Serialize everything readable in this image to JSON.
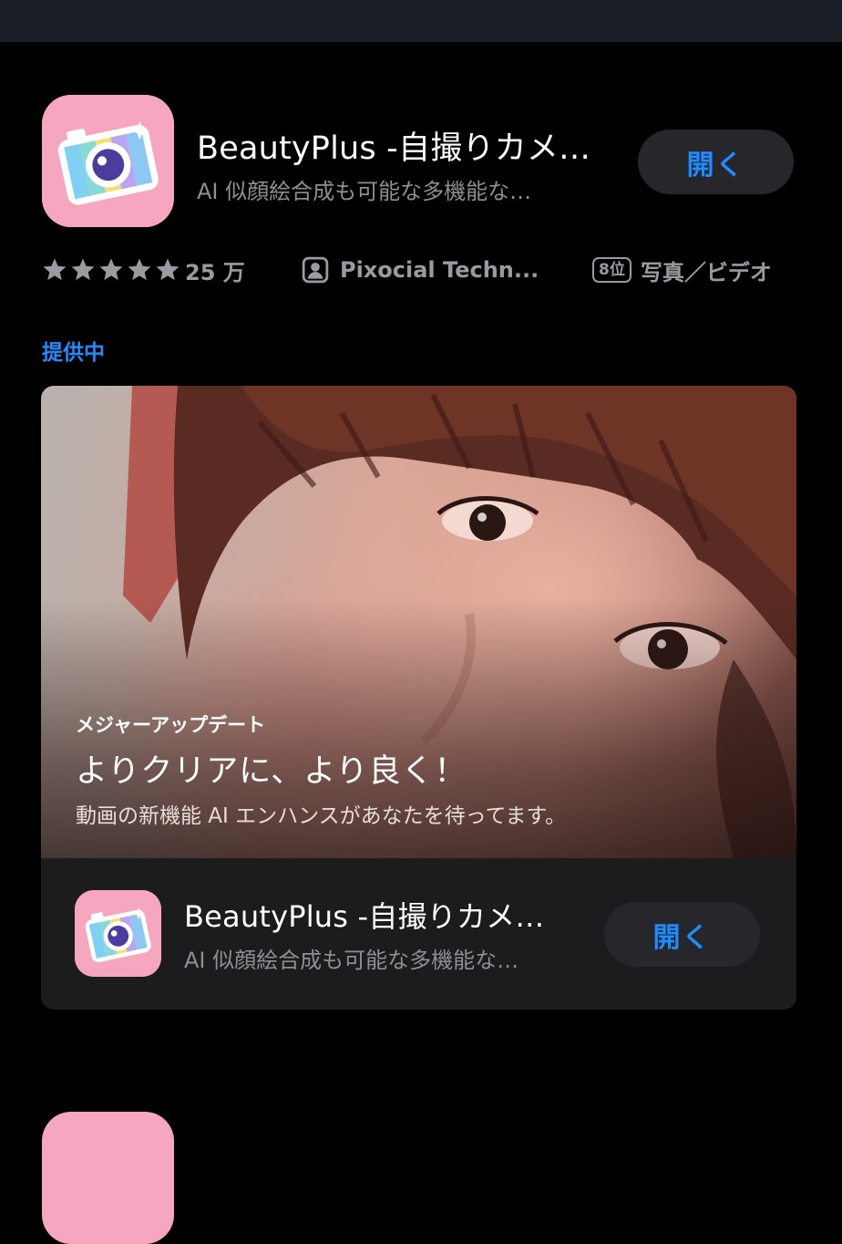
{
  "app": {
    "title": "BeautyPlus -自撮りカメ…",
    "subtitle": "AI 似顔絵合成も可能な多機能な…",
    "open_label": "開く",
    "rating_count": "25 万",
    "developer": "Pixocial Techn...",
    "age_badge": "8位",
    "category": "写真／ビデオ",
    "icon_name": "camera-app-icon"
  },
  "section": {
    "label": "提供中"
  },
  "event_card": {
    "kicker": "メジャーアップデート",
    "headline": "よりクリアに、より良く！",
    "description": "動画の新機能 AI エンハンスがあなたを待ってます。",
    "app_title": "BeautyPlus -自撮りカメ…",
    "app_subtitle": "AI 似顔絵合成も可能な多機能な…",
    "open_label": "開く"
  },
  "colors": {
    "accent": "#1e8bff",
    "background": "#000000",
    "button_bg": "#26262b",
    "icon_pink": "#f7a6bf"
  }
}
